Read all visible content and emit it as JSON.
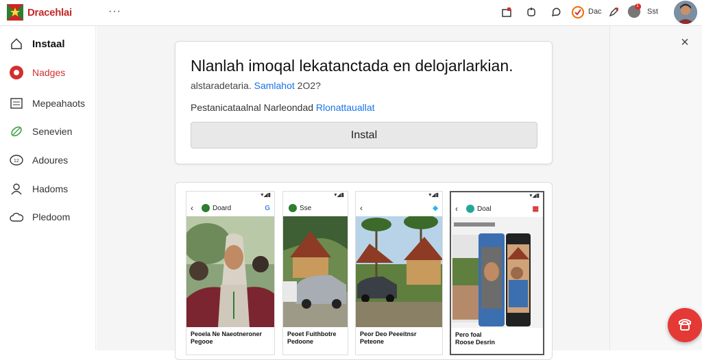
{
  "app": {
    "title": "Dracehlai",
    "menu_dots": "···"
  },
  "topbar": {
    "icons": [
      "notification-icon",
      "share-icon",
      "chat-icon",
      "timer-icon",
      "pen-icon",
      "user-status-icon"
    ],
    "timer_label": "Dac",
    "status_label": "Sst",
    "badge": "1"
  },
  "sidebar": {
    "items": [
      {
        "label": "Instaal",
        "icon": "home-icon",
        "active": true
      },
      {
        "label": "Nadges",
        "icon": "record-icon",
        "accent": true
      },
      {
        "label": "Mepeahaots",
        "icon": "grid-icon"
      },
      {
        "label": "Senevien",
        "icon": "leaf-icon"
      },
      {
        "label": "Adoures",
        "icon": "chat-bubble-icon"
      },
      {
        "label": "Hadoms",
        "icon": "person-icon"
      },
      {
        "label": "Pledoom",
        "icon": "cloud-icon"
      }
    ]
  },
  "card": {
    "title": "Nlanlah imoqal lekatanctada en delojarlarkian.",
    "subtitle_prefix": "alstaradetaria.",
    "subtitle_link": "Samlahot",
    "subtitle_suffix": "2O2?",
    "desc_prefix": "Pestanicataalnal Narleondad",
    "desc_link": "Rlonattauallat",
    "install_label": "Instal"
  },
  "screens": [
    {
      "name": "Doard",
      "caption_1": "Peoela Ne Naeotneroner",
      "caption_2": "Pegooe"
    },
    {
      "name": "Sse",
      "caption_1": "Peoet Fuithbotre",
      "caption_2": "Pedoone"
    },
    {
      "name": "",
      "caption_1": "Peor Deo Peeeitnsr",
      "caption_2": "Peteone"
    },
    {
      "name": "Doal",
      "caption_1": "Pero foal",
      "caption_2": "Roose Desrin"
    }
  ],
  "colors": {
    "accent": "#d32f2f",
    "link": "#1a73e8",
    "button": "#e8e8e8",
    "fab": "#e53935"
  }
}
